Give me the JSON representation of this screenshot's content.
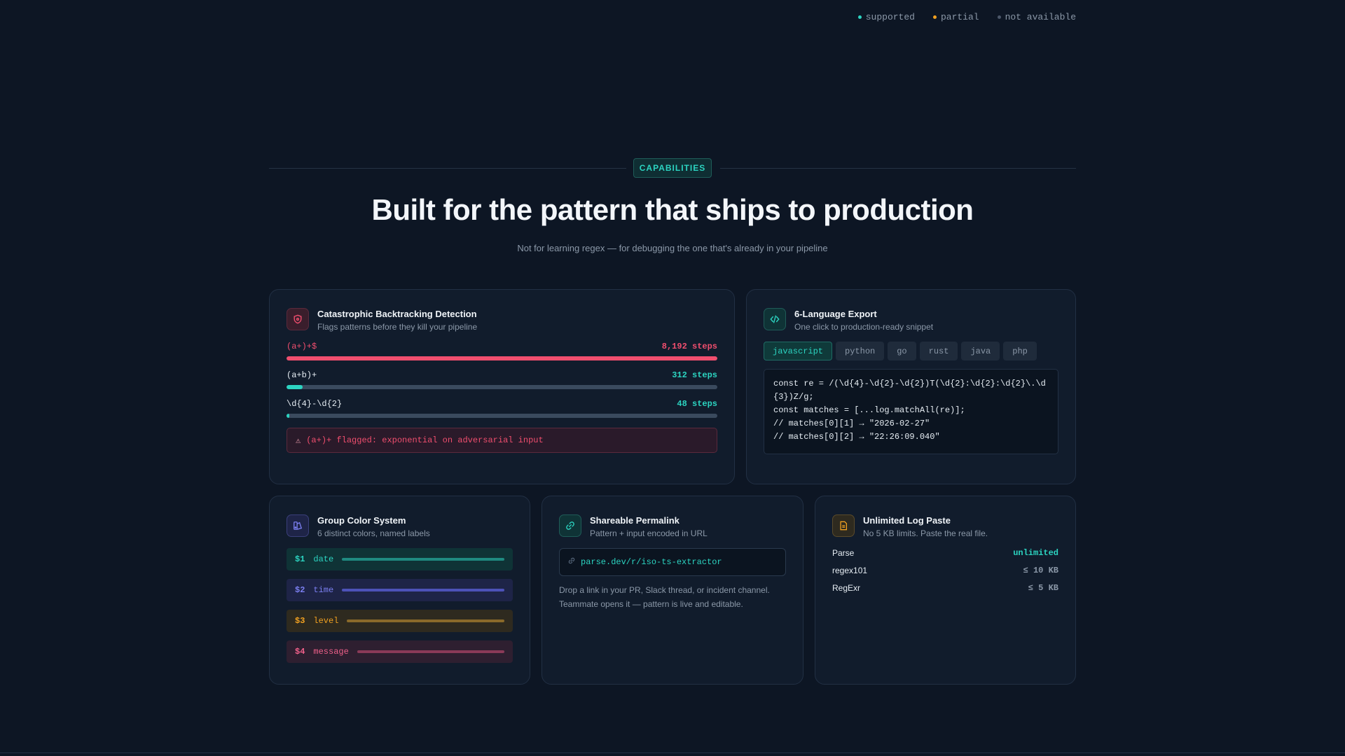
{
  "legend": [
    {
      "label": "supported",
      "color": "#2cd4c1"
    },
    {
      "label": "partial",
      "color": "#f0a020"
    },
    {
      "label": "not available",
      "color": "#4a5668"
    }
  ],
  "section": {
    "badge": "CAPABILITIES",
    "headline": "Built for the pattern that ships to production",
    "subhead": "Not for learning regex — for debugging the one that's already in your pipeline"
  },
  "backtracking": {
    "icon": "shield-icon",
    "title": "Catastrophic Backtracking Detection",
    "subtitle": "Flags patterns before they kill your pipeline",
    "rows": [
      {
        "pattern": "(a+)+$",
        "steps": "8,192 steps",
        "fill": 1.0,
        "color": "#f04e6e",
        "pattern_color": "#f04e6e"
      },
      {
        "pattern": "(a+b)+",
        "steps": "312 steps",
        "fill": 0.038,
        "color": "#2cd4c1",
        "pattern_color": "#e6edf3"
      },
      {
        "pattern": "\\d{4}-\\d{2}",
        "steps": "48 steps",
        "fill": 0.006,
        "color": "#2cd4c1",
        "pattern_color": "#e6edf3"
      }
    ],
    "warning": "(a+)+ flagged: exponential on adversarial input"
  },
  "export": {
    "icon": "code-icon",
    "title": "6-Language Export",
    "subtitle": "One click to production-ready snippet",
    "tabs": [
      "javascript",
      "python",
      "go",
      "rust",
      "java",
      "php"
    ],
    "active_tab": "javascript",
    "code": [
      "const re = /(\\d{4}-\\d{2}-\\d{2})T(\\d{2}:\\d{2}:\\d{2}\\.\\d{3})Z/g;",
      "const matches = [...log.matchAll(re)];",
      "// matches[0][1] → \"2026-02-27\"",
      "// matches[0][2] → \"22:26:09.040\""
    ]
  },
  "groups": {
    "icon": "palette-icon",
    "title": "Group Color System",
    "subtitle": "6 distinct colors, named labels",
    "items": [
      {
        "num": "$1",
        "name": "date",
        "color": "#2cd4c1",
        "bg": "#0f3336",
        "bar": "#1f8a80"
      },
      {
        "num": "$2",
        "name": "time",
        "color": "#7b7ff0",
        "bg": "#1e2447",
        "bar": "#4d52b8"
      },
      {
        "num": "$3",
        "name": "level",
        "color": "#f0a020",
        "bg": "#2e2a1f",
        "bar": "#8a6a2a"
      },
      {
        "num": "$4",
        "name": "message",
        "color": "#f0608a",
        "bg": "#2e1f30",
        "bar": "#8a3a58"
      }
    ]
  },
  "permalink": {
    "icon": "link-icon",
    "title": "Shareable Permalink",
    "subtitle": "Pattern + input encoded in URL",
    "url": "parse.dev/r/iso-ts-extractor",
    "desc1": "Drop a link in your PR, Slack thread, or incident channel.",
    "desc2": "Teammate opens it — pattern is live and editable."
  },
  "logpaste": {
    "icon": "file-icon",
    "title": "Unlimited Log Paste",
    "subtitle": "No 5 KB limits. Paste the real file.",
    "rows": [
      {
        "name": "Parse",
        "value": "unlimited",
        "color": "#2cd4c1"
      },
      {
        "name": "regex101",
        "value": "≤ 10 KB",
        "color": "#8b98a8"
      },
      {
        "name": "RegExr",
        "value": "≤ 5 KB",
        "color": "#8b98a8"
      }
    ]
  }
}
